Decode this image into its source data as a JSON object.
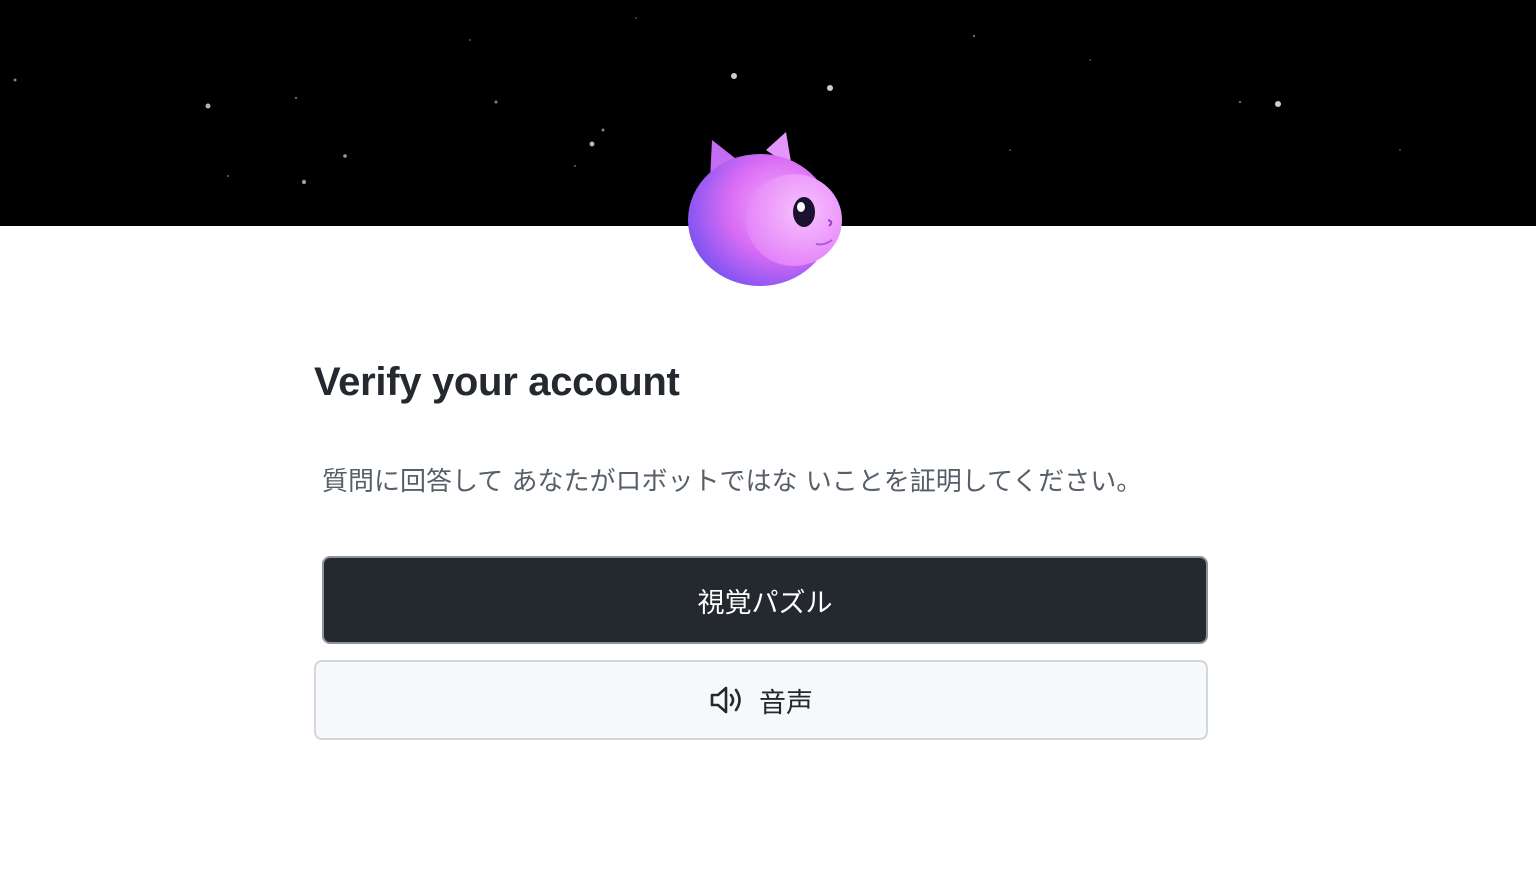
{
  "hero": {
    "mascot_icon": "purple-cat-mascot-icon",
    "background_color": "#000000"
  },
  "title": "Verify your account",
  "subtitle": "質問に回答して あなたがロボットではな いことを証明してください。",
  "buttons": {
    "visual_puzzle_label": "視覚パズル",
    "audio_label": "音声",
    "audio_icon": "speaker-icon"
  },
  "colors": {
    "primary_button_bg": "#24292f",
    "secondary_button_bg": "#f6f8fa",
    "title_text": "#24292f",
    "subtitle_text": "#57606a"
  }
}
